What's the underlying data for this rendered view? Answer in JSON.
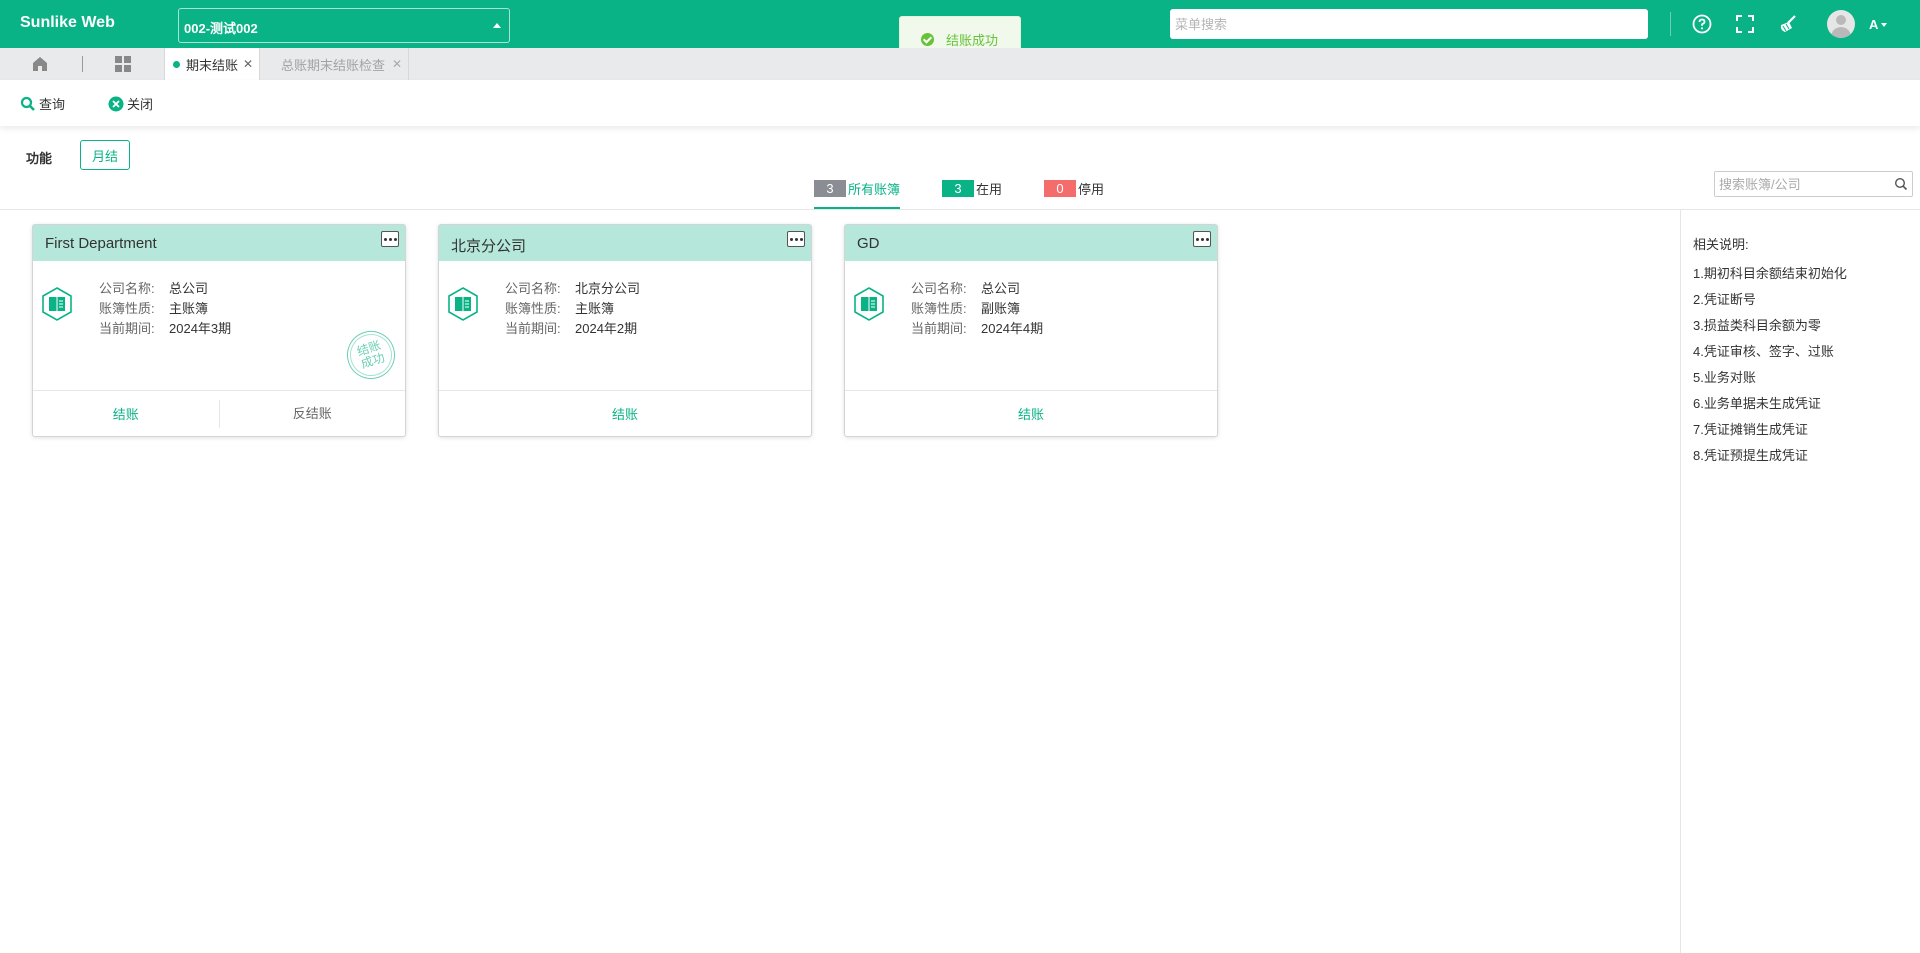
{
  "app": {
    "brand": "Sunlike Web",
    "org_selector": "002-测试002",
    "menu_search_placeholder": "菜单搜索",
    "user_label": "A"
  },
  "toast": {
    "message": "结账成功",
    "type": "success",
    "color": "#67c23a"
  },
  "tabs": [
    {
      "label": "期末结账",
      "active": true
    },
    {
      "label": "总账期末结账检查",
      "active": false
    }
  ],
  "toolbar": {
    "query_label": "查询",
    "close_label": "关闭"
  },
  "function_bar": {
    "label": "功能",
    "monthly_button": "月结"
  },
  "filters": [
    {
      "count": "3",
      "label": "所有账簿",
      "active": true,
      "color": "#8a8d93"
    },
    {
      "count": "3",
      "label": "在用",
      "active": false,
      "color": "#09b386"
    },
    {
      "count": "0",
      "label": "停用",
      "active": false,
      "color": "#f56c6c"
    }
  ],
  "book_search_placeholder": "搜索账簿/公司",
  "cards": [
    {
      "title": "First Department",
      "company_label": "公司名称:",
      "company": "总公司",
      "type_label": "账簿性质:",
      "type": "主账簿",
      "period_label": "当前期间:",
      "period": "2024年3期",
      "stamp": "结账成功",
      "close_button": "结账",
      "reverse_button": "反结账"
    },
    {
      "title": "北京分公司",
      "company_label": "公司名称:",
      "company": "北京分公司",
      "type_label": "账簿性质:",
      "type": "主账簿",
      "period_label": "当前期间:",
      "period": "2024年2期",
      "close_button": "结账"
    },
    {
      "title": "GD",
      "company_label": "公司名称:",
      "company": "总公司",
      "type_label": "账簿性质:",
      "type": "副账簿",
      "period_label": "当前期间:",
      "period": "2024年4期",
      "close_button": "结账"
    }
  ],
  "notes": {
    "title": "相关说明:",
    "items": [
      "1.期初科目余额结束初始化",
      "2.凭证断号",
      "3.损益类科目余额为零",
      "4.凭证审核、签字、过账",
      "5.业务对账",
      "6.业务单据未生成凭证",
      "7.凭证摊销生成凭证",
      "8.凭证预提生成凭证"
    ]
  },
  "colors": {
    "primary": "#09b386",
    "card_header": "#b5e8da"
  }
}
